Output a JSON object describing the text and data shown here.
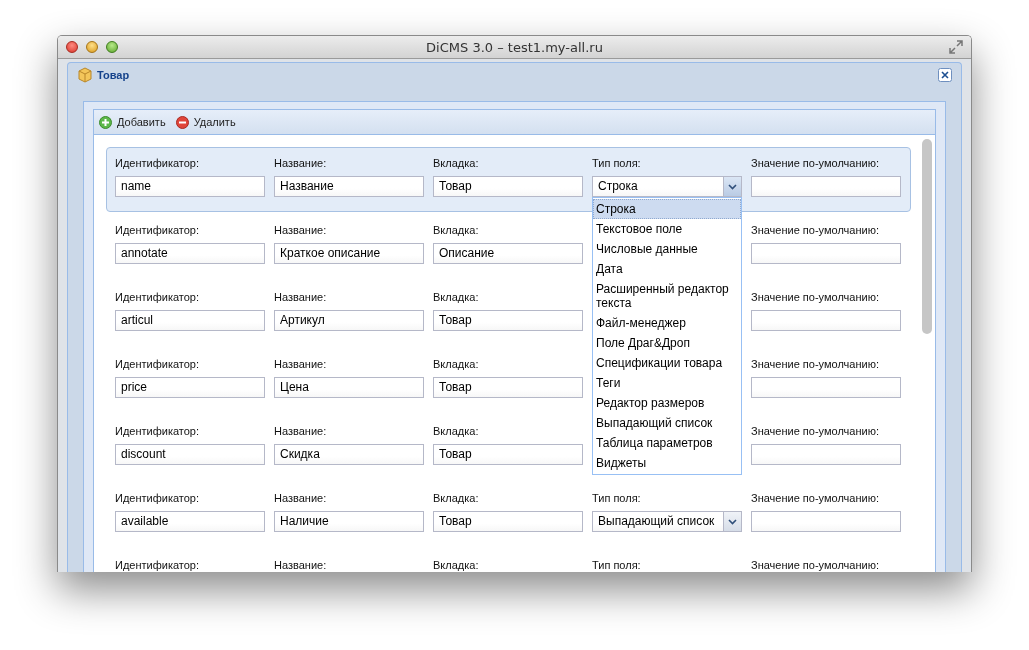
{
  "window": {
    "title": "DiCMS 3.0 – test1.my-all.ru"
  },
  "dialog": {
    "title": "Товар"
  },
  "toolbar": [
    {
      "kind": "add",
      "label": "Добавить"
    },
    {
      "kind": "delete",
      "label": "Удалить"
    }
  ],
  "rows": [
    {
      "selected": true,
      "cells": [
        {
          "kind": "text",
          "label": "Идентификатор:",
          "value": "name"
        },
        {
          "kind": "text",
          "label": "Название:",
          "value": "Название"
        },
        {
          "kind": "text",
          "label": "Вкладка:",
          "value": "Товар"
        },
        {
          "kind": "select",
          "label": "Тип поля:",
          "value": "Строка",
          "open": true,
          "options": [
            {
              "label": "Строка",
              "selected": true
            },
            {
              "label": "Текстовое поле",
              "selected": false
            },
            {
              "label": "Числовые данные",
              "selected": false
            },
            {
              "label": "Дата",
              "selected": false
            },
            {
              "label": "Расширенный редактор текста",
              "selected": false
            },
            {
              "label": "Файл-менеджер",
              "selected": false
            },
            {
              "label": "Поле Драг&Дроп",
              "selected": false
            },
            {
              "label": "Спецификации товара",
              "selected": false
            },
            {
              "label": "Теги",
              "selected": false
            },
            {
              "label": "Редактор размеров",
              "selected": false
            },
            {
              "label": "Выпадающий список",
              "selected": false
            },
            {
              "label": "Таблица параметров",
              "selected": false
            },
            {
              "label": "Виджеты",
              "selected": false
            }
          ]
        },
        {
          "kind": "text",
          "label": "Значение по-умолчанию:"
        }
      ]
    },
    {
      "selected": false,
      "cells": [
        {
          "kind": "text",
          "label": "Идентификатор:",
          "value": "annotate"
        },
        {
          "kind": "text",
          "label": "Название:",
          "value": "Краткое описание"
        },
        {
          "kind": "text",
          "label": "Вкладка:",
          "value": "Описание"
        },
        {
          "kind": "covered"
        },
        {
          "kind": "text",
          "label": "Значение по-умолчанию:"
        }
      ]
    },
    {
      "selected": false,
      "cells": [
        {
          "kind": "text",
          "label": "Идентификатор:",
          "value": "articul"
        },
        {
          "kind": "text",
          "label": "Название:",
          "value": "Артикул"
        },
        {
          "kind": "text",
          "label": "Вкладка:",
          "value": "Товар"
        },
        {
          "kind": "covered"
        },
        {
          "kind": "text",
          "label": "Значение по-умолчанию:"
        }
      ]
    },
    {
      "selected": false,
      "cells": [
        {
          "kind": "text",
          "label": "Идентификатор:",
          "value": "price"
        },
        {
          "kind": "text",
          "label": "Название:",
          "value": "Цена"
        },
        {
          "kind": "text",
          "label": "Вкладка:",
          "value": "Товар"
        },
        {
          "kind": "covered"
        },
        {
          "kind": "text",
          "label": "Значение по-умолчанию:"
        }
      ]
    },
    {
      "selected": false,
      "cells": [
        {
          "kind": "text",
          "label": "Идентификатор:",
          "value": "discount"
        },
        {
          "kind": "text",
          "label": "Название:",
          "value": "Скидка"
        },
        {
          "kind": "text",
          "label": "Вкладка:",
          "value": "Товар"
        },
        {
          "kind": "covered"
        },
        {
          "kind": "text",
          "label": "Значение по-умолчанию:"
        }
      ]
    },
    {
      "selected": false,
      "cells": [
        {
          "kind": "text",
          "label": "Идентификатор:",
          "value": "available"
        },
        {
          "kind": "text",
          "label": "Название:",
          "value": "Наличие"
        },
        {
          "kind": "text",
          "label": "Вкладка:",
          "value": "Товар"
        },
        {
          "kind": "select",
          "label": "Тип поля:",
          "value": "Выпадающий список",
          "open": false
        },
        {
          "kind": "text",
          "label": "Значение по-умолчанию:"
        }
      ]
    },
    {
      "selected": false,
      "cells": [
        {
          "kind": "label",
          "label": "Идентификатор:"
        },
        {
          "kind": "label",
          "label": "Название:"
        },
        {
          "kind": "label",
          "label": "Вкладка:"
        },
        {
          "kind": "label",
          "label": "Тип поля:"
        },
        {
          "kind": "label",
          "label": "Значение по-умолчанию:"
        }
      ]
    }
  ]
}
